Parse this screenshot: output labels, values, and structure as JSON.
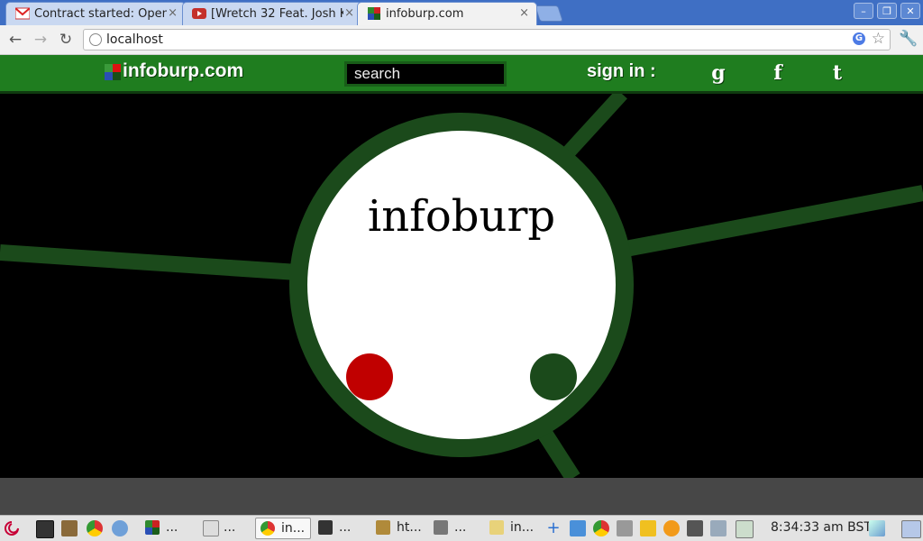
{
  "browser": {
    "tabs": [
      {
        "title": "Contract started: Open",
        "favicon": "gmail-icon",
        "active": false
      },
      {
        "title": "[Wretch 32 Feat. Josh K",
        "favicon": "youtube-icon",
        "active": false
      },
      {
        "title": "infoburp.com",
        "favicon": "infoburp-icon",
        "active": true
      }
    ],
    "close_glyph": "×",
    "address": "localhost",
    "window_controls": [
      "minimize-icon",
      "restore-icon",
      "close-icon"
    ]
  },
  "site": {
    "logo_text": "infoburp.com",
    "search_placeholder": "search",
    "signin_label": "sign in :",
    "social": [
      {
        "name": "google",
        "glyph": "g"
      },
      {
        "name": "facebook",
        "glyph": "f"
      },
      {
        "name": "tumblr",
        "glyph": "t"
      }
    ],
    "colors": {
      "header_green": "#1f7d1f",
      "node_ring": "#1b4a1b",
      "red_dot": "#c00000",
      "green_dot": "#1b4a1b"
    }
  },
  "graph": {
    "center_node_label": "infoburp"
  },
  "taskbar": {
    "tasks": [
      {
        "label": "...",
        "icon": "infoburp-icon"
      },
      {
        "label": "...",
        "icon": "document-icon"
      },
      {
        "label": "in...",
        "icon": "chrome-icon",
        "active": true
      },
      {
        "label": "...",
        "icon": "terminal-icon"
      },
      {
        "label": "ht...",
        "icon": "archive-icon"
      },
      {
        "label": "...",
        "icon": "calculator-icon"
      },
      {
        "label": "in...",
        "icon": "text-editor-icon"
      }
    ],
    "clock": "8:34:33 am BST"
  }
}
